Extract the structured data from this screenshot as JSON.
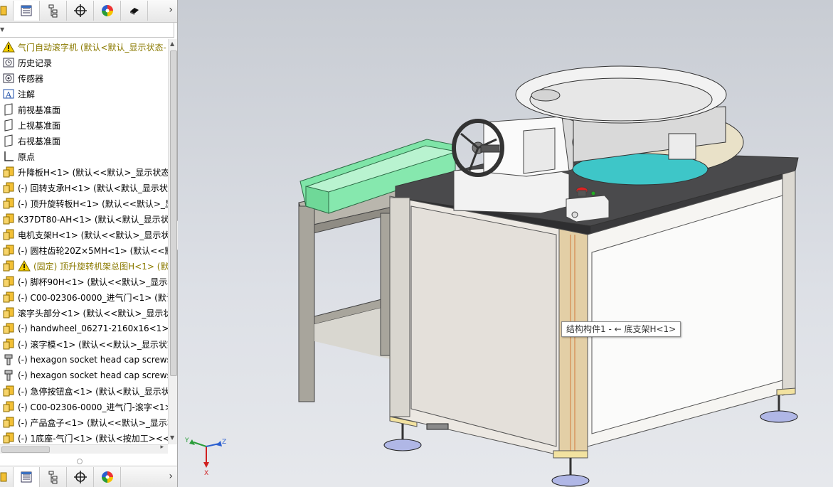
{
  "panel": {
    "tabs": [
      "feature-manager",
      "property-manager",
      "configuration-manager",
      "dimxpert-manager",
      "display-manager",
      "extra-manager"
    ],
    "tree": [
      {
        "icon": "warning-assembly-icon",
        "label": "气门自动滚字机  (默认<默认_显示状态-",
        "warn": true
      },
      {
        "icon": "history-icon",
        "label": "历史记录"
      },
      {
        "icon": "sensor-icon",
        "label": "传感器"
      },
      {
        "icon": "annotation-icon",
        "label": "注解"
      },
      {
        "icon": "plane-icon",
        "label": "前视基准面"
      },
      {
        "icon": "plane-icon",
        "label": "上视基准面"
      },
      {
        "icon": "plane-icon",
        "label": "右视基准面"
      },
      {
        "icon": "origin-icon",
        "label": "原点"
      },
      {
        "icon": "assembly-icon",
        "label": "升降板H<1> (默认<<默认>_显示状态"
      },
      {
        "icon": "assembly-icon",
        "label": "(-) 回转支承H<1> (默认<默认_显示状态"
      },
      {
        "icon": "assembly-icon",
        "label": "(-) 顶升旋转板H<1> (默认<<默认>_显"
      },
      {
        "icon": "assembly-icon",
        "label": "K37DT80-AH<1> (默认<默认_显示状态"
      },
      {
        "icon": "assembly-icon",
        "label": "电机支架H<1> (默认<<默认>_显示状态"
      },
      {
        "icon": "assembly-icon",
        "label": "(-) 圆柱齿轮20Z×5MH<1> (默认<<默认"
      },
      {
        "icon": "assembly-warning-icon",
        "label": "(固定) 顶升旋转机架总图H<1> (默认",
        "warn": true
      },
      {
        "icon": "assembly-icon",
        "label": "(-) 脚杯90H<1> (默认<<默认>_显示状"
      },
      {
        "icon": "assembly-icon",
        "label": "(-) C00-02306-0000_进气门<1> (默认"
      },
      {
        "icon": "assembly-icon",
        "label": "滚字头部分<1> (默认<<默认>_显示状"
      },
      {
        "icon": "assembly-icon",
        "label": "(-) handwheel_06271-2160x16<1> (D"
      },
      {
        "icon": "assembly-icon",
        "label": "(-) 滚字模<1> (默认<<默认>_显示状态"
      },
      {
        "icon": "screw-icon",
        "label": "(-) hexagon socket head cap screws"
      },
      {
        "icon": "screw-icon",
        "label": "(-) hexagon socket head cap screws"
      },
      {
        "icon": "assembly-icon",
        "label": "(-) 急停按钮盒<1> (默认<默认_显示状"
      },
      {
        "icon": "assembly-icon",
        "label": "(-) C00-02306-0000_进气门-滚字<1>"
      },
      {
        "icon": "assembly-icon",
        "label": "(-) 产品盒子<1> (默认<<默认>_显示状"
      },
      {
        "icon": "assembly-icon",
        "label": "(-) 1底座-气门<1> (默认<按加工><<剌"
      }
    ],
    "hscroll_label": "III",
    "expand_arrow": "›"
  },
  "viewport": {
    "tooltip": "结构构件1 - ← 底支架H<1>",
    "triad": {
      "x": "X",
      "y": "Y",
      "z": "Z"
    }
  }
}
